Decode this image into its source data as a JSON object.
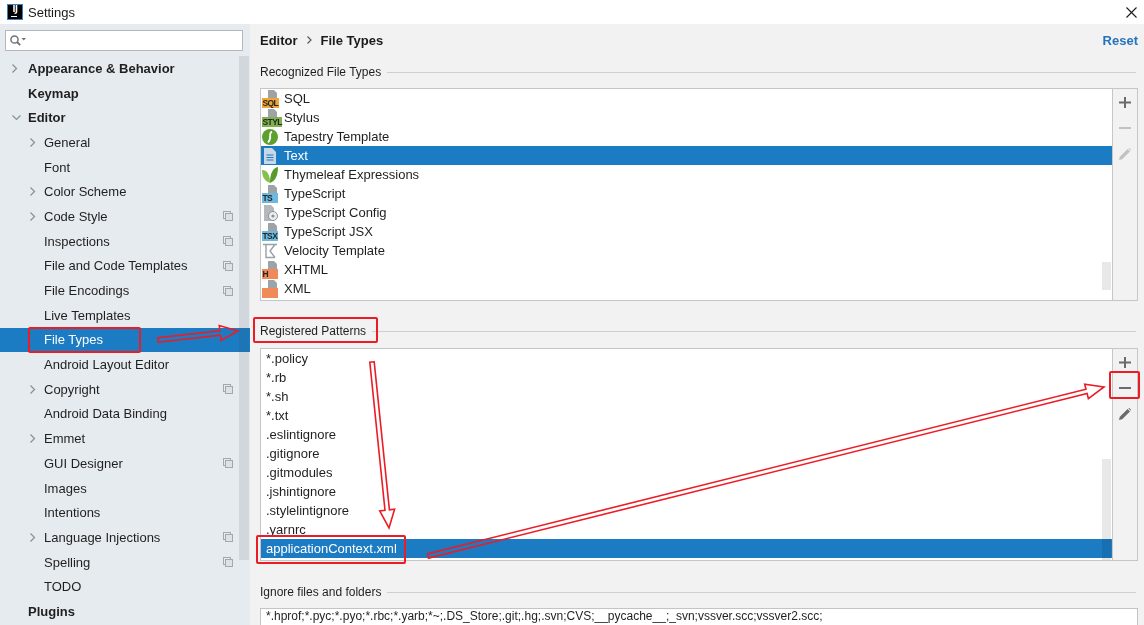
{
  "window": {
    "logo": "IJ",
    "title": "Settings"
  },
  "sidebar": {
    "items": [
      {
        "label": "Appearance & Behavior",
        "expanded": false,
        "selected": false,
        "per_project": false,
        "annotated": false
      },
      {
        "label": "Keymap",
        "selected": false,
        "per_project": false,
        "annotated": false
      },
      {
        "label": "Editor",
        "expanded": true,
        "selected": false,
        "per_project": false,
        "annotated": false,
        "children": [
          {
            "label": "General",
            "expanded": false,
            "selected": false,
            "per_project": false,
            "annotated": false
          },
          {
            "label": "Font",
            "selected": false,
            "per_project": false,
            "annotated": false
          },
          {
            "label": "Color Scheme",
            "expanded": false,
            "selected": false,
            "per_project": false,
            "annotated": false
          },
          {
            "label": "Code Style",
            "expanded": false,
            "selected": false,
            "per_project": true,
            "annotated": false
          },
          {
            "label": "Inspections",
            "selected": false,
            "per_project": true,
            "annotated": false
          },
          {
            "label": "File and Code Templates",
            "selected": false,
            "per_project": true,
            "annotated": false
          },
          {
            "label": "File Encodings",
            "selected": false,
            "per_project": true,
            "annotated": false
          },
          {
            "label": "Live Templates",
            "selected": false,
            "per_project": false,
            "annotated": false
          },
          {
            "label": "File Types",
            "selected": true,
            "per_project": false,
            "annotated": true
          },
          {
            "label": "Android Layout Editor",
            "selected": false,
            "per_project": false,
            "annotated": false
          },
          {
            "label": "Copyright",
            "expanded": false,
            "selected": false,
            "per_project": true,
            "annotated": false
          },
          {
            "label": "Android Data Binding",
            "selected": false,
            "per_project": false,
            "annotated": false
          },
          {
            "label": "Emmet",
            "expanded": false,
            "selected": false,
            "per_project": false,
            "annotated": false
          },
          {
            "label": "GUI Designer",
            "selected": false,
            "per_project": true,
            "annotated": false
          },
          {
            "label": "Images",
            "selected": false,
            "per_project": false,
            "annotated": false
          },
          {
            "label": "Intentions",
            "selected": false,
            "per_project": false,
            "annotated": false
          },
          {
            "label": "Language Injections",
            "expanded": false,
            "selected": false,
            "per_project": true,
            "annotated": false
          },
          {
            "label": "Spelling",
            "selected": false,
            "per_project": true,
            "annotated": false
          },
          {
            "label": "TODO",
            "selected": false,
            "per_project": false,
            "annotated": false
          }
        ]
      },
      {
        "label": "Plugins",
        "selected": false,
        "per_project": false,
        "annotated": false
      }
    ]
  },
  "header": {
    "breadcrumb": [
      "Editor",
      "File Types"
    ],
    "reset_link": "Reset"
  },
  "recognized_file_types": {
    "title": "Recognized File Types",
    "annotated": false,
    "items": [
      {
        "name": "SQL",
        "kind": "band",
        "badge": "SQL",
        "color": "#f0a535",
        "selected": false
      },
      {
        "name": "Stylus",
        "kind": "band",
        "badge": "STYL",
        "color": "#7fb24e",
        "selected": false
      },
      {
        "name": "Tapestry Template",
        "kind": "swirl",
        "selected": false
      },
      {
        "name": "Text",
        "kind": "text",
        "selected": true
      },
      {
        "name": "Thymeleaf Expressions",
        "kind": "leaf",
        "selected": false
      },
      {
        "name": "TypeScript",
        "kind": "band",
        "badge": "TS",
        "color": "#6cb8de",
        "selected": false
      },
      {
        "name": "TypeScript Config",
        "kind": "config",
        "selected": false
      },
      {
        "name": "TypeScript JSX",
        "kind": "band",
        "badge": "TSX",
        "color": "#6cb8de",
        "selected": false
      },
      {
        "name": "Velocity Template",
        "kind": "template",
        "selected": false
      },
      {
        "name": "XHTML",
        "kind": "band",
        "badge": "H",
        "color": "#f08a58",
        "selected": false
      },
      {
        "name": "XML",
        "kind": "band",
        "color": "#f08a58",
        "selected": false
      }
    ],
    "toolbar": [
      {
        "kind": "add",
        "disabled": false,
        "annotated": false
      },
      {
        "kind": "remove",
        "disabled": true,
        "annotated": false
      },
      {
        "kind": "edit",
        "disabled": true,
        "annotated": false
      }
    ]
  },
  "registered_patterns": {
    "title": "Registered Patterns",
    "annotated": true,
    "items": [
      {
        "pattern": "*.policy",
        "selected": false,
        "annotated": false
      },
      {
        "pattern": "*.rb",
        "selected": false,
        "annotated": false
      },
      {
        "pattern": "*.sh",
        "selected": false,
        "annotated": false
      },
      {
        "pattern": "*.txt",
        "selected": false,
        "annotated": false
      },
      {
        "pattern": ".eslintignore",
        "selected": false,
        "annotated": false
      },
      {
        "pattern": ".gitignore",
        "selected": false,
        "annotated": false
      },
      {
        "pattern": ".gitmodules",
        "selected": false,
        "annotated": false
      },
      {
        "pattern": ".jshintignore",
        "selected": false,
        "annotated": false
      },
      {
        "pattern": ".stylelintignore",
        "selected": false,
        "annotated": false
      },
      {
        "pattern": ".yarnrc",
        "selected": false,
        "annotated": false
      },
      {
        "pattern": "applicationContext.xml",
        "selected": true,
        "annotated": true
      }
    ],
    "toolbar": [
      {
        "kind": "add",
        "disabled": false,
        "annotated": false
      },
      {
        "kind": "remove",
        "disabled": false,
        "annotated": true
      },
      {
        "kind": "edit",
        "disabled": false,
        "annotated": false
      }
    ]
  },
  "ignore_files": {
    "title": "Ignore files and folders",
    "annotated": false,
    "value": "*.hprof;*.pyc;*.pyo;*.rbc;*.yarb;*~;.DS_Store;.git;.hg;.svn;CVS;__pycache__;_svn;vssver.scc;vssver2.scc;"
  },
  "annotation_arrows": [
    {
      "kind": "right"
    },
    {
      "kind": "down"
    },
    {
      "kind": "diagonal"
    }
  ]
}
